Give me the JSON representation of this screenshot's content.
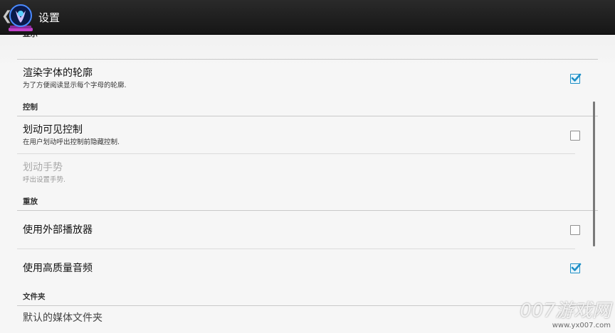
{
  "actionbar": {
    "back_glyph": "❮",
    "app_icon": "app-logo-icon",
    "title": "设置"
  },
  "sections": {
    "partial_top_category": "显示",
    "render_outline": {
      "title": "渲染字体的轮廓",
      "summary": "为了方便阅读显示每个字母的轮廓.",
      "checked": true
    },
    "controls_category": "控制",
    "swipe_controls": {
      "title": "划动可见控制",
      "summary": "在用户划动呼出控制前隐藏控制.",
      "checked": false
    },
    "swipe_gestures": {
      "title": "划动手势",
      "summary": "呼出设置手势.",
      "enabled": false
    },
    "playback_category": "重放",
    "external_player": {
      "title": "使用外部播放器",
      "checked": false
    },
    "hq_audio": {
      "title": "使用高质量音频",
      "checked": true
    },
    "folders_category": "文件夹",
    "partial_bottom_item": "默认的媒体文件夹"
  },
  "watermark": {
    "main": "007游戏网",
    "url": "www.yx007.com"
  },
  "colors": {
    "accent": "#1d8fc6",
    "actionbar": "#1e1e1e"
  }
}
